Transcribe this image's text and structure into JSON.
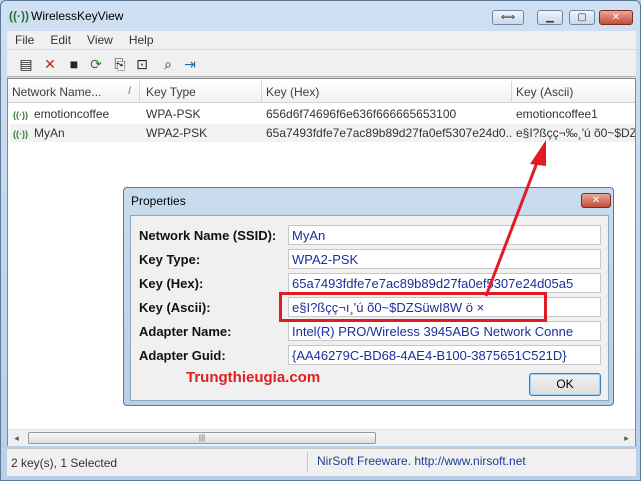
{
  "window": {
    "title": "WirelessKeyView"
  },
  "menu": [
    "File",
    "Edit",
    "View",
    "Help"
  ],
  "toolbar": {
    "icons": [
      "properties-icon",
      "delete-icon",
      "save-icon",
      "refresh-icon",
      "copy-icon",
      "export-icon",
      "find-icon",
      "exit-icon"
    ],
    "glyphs": [
      "▤",
      "✕",
      "■",
      "⟳",
      "⎘",
      "⊡",
      "⌕",
      "⇥"
    ]
  },
  "list": {
    "columns": [
      "Network Name...",
      "Key Type",
      "Key (Hex)",
      "Key (Ascii)"
    ],
    "sort_glyph": "/",
    "rows": [
      {
        "name": "emotioncoffee",
        "type": "WPA-PSK",
        "hex": "656d6f74696f6e636f666665653100",
        "ascii": "emotioncoffee1"
      },
      {
        "name": "MyAn",
        "type": "WPA2-PSK",
        "hex": "65a7493fdfe7e7ac89b89d27fa0ef5307e24d0...",
        "ascii": "e§I?ßçç¬‰¸'ú õ0~$DZ"
      }
    ]
  },
  "scrollbar": {
    "left": "◂",
    "right": "▸",
    "grip": "|||"
  },
  "status": {
    "left": "2 key(s), 1 Selected",
    "right": "NirSoft Freeware.  http://www.nirsoft.net"
  },
  "dialog": {
    "title": "Properties",
    "close_label": "✕",
    "fields": [
      {
        "label": "Network Name (SSID):",
        "value": "MyAn"
      },
      {
        "label": "Key Type:",
        "value": "WPA2-PSK"
      },
      {
        "label": "Key (Hex):",
        "value": "65a7493fdfe7e7ac89b89d27fa0ef5307e24d05a5"
      },
      {
        "label": "Key (Ascii):",
        "value": "e§I?ßçç¬ı¸'ú õ0~$DZSüwI8W ö  ×"
      },
      {
        "label": "Adapter Name:",
        "value": "Intel(R) PRO/Wireless 3945ABG Network Conne"
      },
      {
        "label": "Adapter Guid:",
        "value": "{AA46279C-BD68-4AE4-B100-3875651C521D}"
      }
    ],
    "ok_label": "OK",
    "watermark": "Trungthieugia.com"
  },
  "colors": {
    "annotation": "#e01b24",
    "field_text": "#1a2f9e",
    "link": "#1a3f9a"
  }
}
